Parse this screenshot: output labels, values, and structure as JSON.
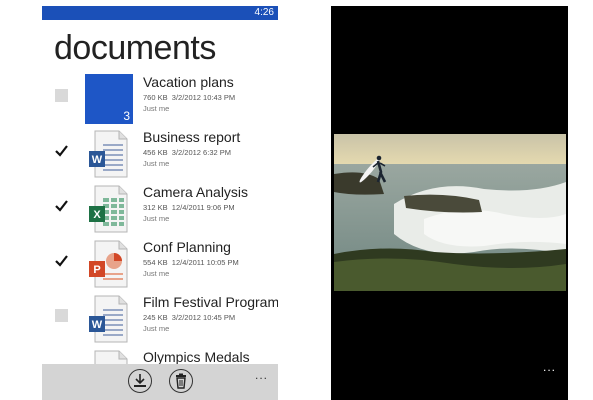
{
  "status": {
    "time": "4:26"
  },
  "page": {
    "title": "documents"
  },
  "documents": [
    {
      "name": "Vacation plans",
      "size": "760 KB",
      "date": "3/2/2012 10:43 PM",
      "owner": "Just me",
      "checked": false,
      "kind": "folder",
      "count": "3"
    },
    {
      "name": "Business report",
      "size": "456 KB",
      "date": "3/2/2012 6:32 PM",
      "owner": "Just me",
      "checked": true,
      "kind": "word"
    },
    {
      "name": "Camera Analysis",
      "size": "312 KB",
      "date": "12/4/2011 9:06 PM",
      "owner": "Just me",
      "checked": true,
      "kind": "excel"
    },
    {
      "name": "Conf Planning",
      "size": "554 KB",
      "date": "12/4/2011 10:05 PM",
      "owner": "Just me",
      "checked": true,
      "kind": "powerpoint"
    },
    {
      "name": "Film Festival Program",
      "size": "245 KB",
      "date": "3/2/2012 10:45 PM",
      "owner": "Just me",
      "checked": false,
      "kind": "word"
    },
    {
      "name": "Olympics Medals",
      "size": "",
      "date": "",
      "owner": "",
      "checked": false,
      "kind": "word"
    }
  ],
  "appbar": {
    "more": "..."
  },
  "viewer": {
    "more": "..."
  },
  "colors": {
    "accent": "#1e56c6",
    "statusbar": "#1b50b8",
    "word": "#2b5797",
    "excel": "#1e7145",
    "powerpoint": "#d24726"
  },
  "icons": {
    "download": "download-icon",
    "delete": "delete-icon"
  }
}
